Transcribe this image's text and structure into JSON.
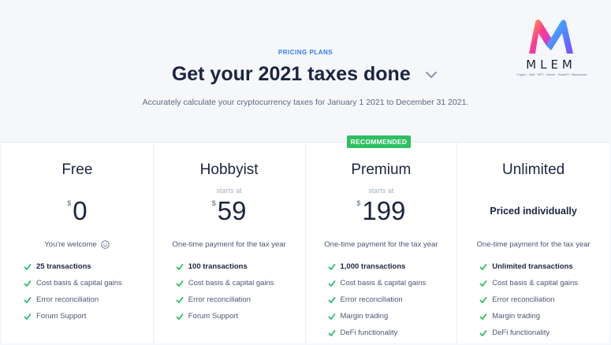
{
  "header": {
    "eyebrow": "PRICING PLANS",
    "title": "Get your 2021 taxes done",
    "subtitle": "Accurately calculate your cryptocurrency taxes for January 1 2021 to December 31 2021."
  },
  "logo": {
    "word": "MLEM",
    "tagline": "· Crypto · Defi · NFT · Game · GameFi · Blockchain ·"
  },
  "colors": {
    "accent": "#2f7bf6",
    "check": "#2dbf61",
    "badge": "#2dbf61"
  },
  "plans": [
    {
      "name": "Free",
      "currency": "$",
      "amount": "0",
      "note": "You're welcome",
      "features": [
        "25 transactions",
        "Cost basis & capital gains",
        "Error reconciliation",
        "Forum Support"
      ]
    },
    {
      "name": "Hobbyist",
      "starts_at": "starts at",
      "currency": "$",
      "amount": "59",
      "note": "One-time payment for the tax year",
      "features": [
        "100 transactions",
        "Cost basis & capital gains",
        "Error reconciliation",
        "Forum Support"
      ]
    },
    {
      "name": "Premium",
      "badge": "RECOMMENDED",
      "starts_at": "starts at",
      "currency": "$",
      "amount": "199",
      "note": "One-time payment for the tax year",
      "features": [
        "1,000 transactions",
        "Cost basis & capital gains",
        "Error reconciliation",
        "Margin trading",
        "DeFi functionality"
      ]
    },
    {
      "name": "Unlimited",
      "priced": "Priced individually",
      "note": "One-time payment for the tax year",
      "features": [
        "Unlimited transactions",
        "Cost basis & capital gains",
        "Error reconciliation",
        "Margin trading",
        "DeFi functionality"
      ]
    }
  ]
}
